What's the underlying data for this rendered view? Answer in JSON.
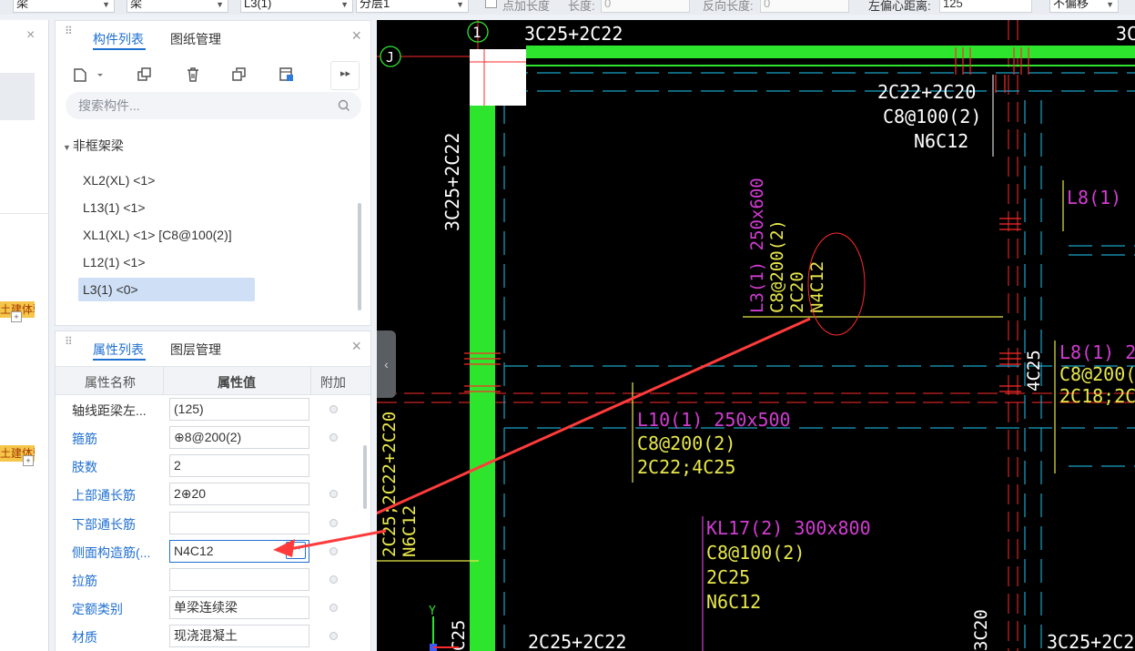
{
  "toolbar": {
    "type_select_1": "梁",
    "type_select_2": "梁",
    "name_select": "L3(1)",
    "layer_select": "分层1",
    "add_length_label": "点加长度",
    "length_label": "长度:",
    "length_value": "0",
    "reverse_length_label": "反向长度:",
    "reverse_length_value": "0",
    "offset_label": "左偏心距离:",
    "offset_value": "125",
    "offset_mode": "不偏移"
  },
  "left_badges": [
    "土建体验",
    "土建体验"
  ],
  "component_panel": {
    "tabs": [
      {
        "label": "构件列表"
      },
      {
        "label": "图纸管理"
      }
    ],
    "search_placeholder": "搜索构件...",
    "category": "非框架梁",
    "items": [
      {
        "label": "XL2(XL) <1>"
      },
      {
        "label": "L13(1) <1>"
      },
      {
        "label": "XL1(XL) <1> [C8@100(2)]"
      },
      {
        "label": "L12(1) <1>"
      },
      {
        "label": "L3(1) <0>"
      }
    ],
    "selected_index": 4
  },
  "property_panel": {
    "tabs": [
      {
        "label": "属性列表"
      },
      {
        "label": "图层管理"
      }
    ],
    "columns": [
      "属性名称",
      "属性值",
      "附加"
    ],
    "rows": [
      {
        "name": "轴线距梁左...",
        "value": "(125)"
      },
      {
        "name": "箍筋",
        "value": "⊕8@200(2)"
      },
      {
        "name": "肢数",
        "value": "2"
      },
      {
        "name": "上部通长筋",
        "value": "2⊕20"
      },
      {
        "name": "下部通长筋",
        "value": ""
      },
      {
        "name": "侧面构造筋(...",
        "value": "N4C12"
      },
      {
        "name": "拉筋",
        "value": ""
      },
      {
        "name": "定额类别",
        "value": "单梁连续梁"
      },
      {
        "name": "材质",
        "value": "现浇混凝土"
      }
    ]
  },
  "drawing": {
    "axis_labels": [
      "1",
      "J"
    ],
    "top_left_beam": "3C25+2C22",
    "top_right_fragment": "3C",
    "vertical_left": "3C25+2C22",
    "right_block": [
      "2C22+2C20",
      "C8@100(2)",
      "N6C12"
    ],
    "l8_top": "L8(1)",
    "l3_vertical": [
      "L3(1) 250x600",
      "C8@200(2)",
      "2C20",
      "N4C12"
    ],
    "c4c25": "4C25",
    "l8_right": [
      "L8(1) 2",
      "C8@200(",
      "2C18;2C"
    ],
    "l10": [
      "L10(1) 250x500",
      "C8@200(2)",
      "2C22;4C25"
    ],
    "kl17": [
      "KL17(2) 300x800",
      "C8@100(2)",
      "2C25",
      "N6C12"
    ],
    "left_vertical_strings": [
      "2C25;2C22+2C20",
      "N6C12"
    ],
    "bottom_left": "2C25+2C22",
    "bottom_right": "3C25+2C2",
    "bottom_vert_3c20": "3C20",
    "bottom_vert_c25": "C25",
    "y_axis_label": "Y",
    "colors": {
      "beam_green": "#2ee52e",
      "text_yellow": "#e8e84a",
      "text_magenta": "#d23cd2",
      "text_white": "#ffffff",
      "axis_red": "#ff2a2a",
      "dash_cyan": "#1aa4c8"
    }
  }
}
